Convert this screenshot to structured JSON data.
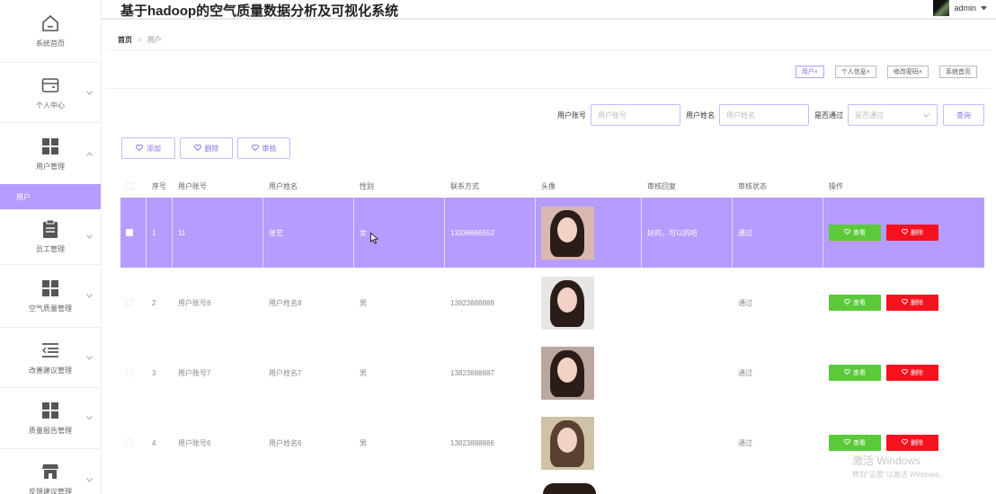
{
  "header": {
    "title": "基于hadoop的空气质量数据分析及可视化系统",
    "user": "admin"
  },
  "sidebar": {
    "home": "系统首页",
    "items": [
      {
        "label": "个人中心",
        "icon": "wallet-icon"
      },
      {
        "label": "用户管理",
        "icon": "grid-icon",
        "expanded": true,
        "sub": [
          "用户"
        ]
      },
      {
        "label": "员工管理",
        "icon": "clipboard-icon"
      },
      {
        "label": "空气质量管理",
        "icon": "grid-icon"
      },
      {
        "label": "改善建议管理",
        "icon": "list-indent-icon"
      },
      {
        "label": "质量报告管理",
        "icon": "grid-icon"
      },
      {
        "label": "反馈建议管理",
        "icon": "shop-icon"
      }
    ]
  },
  "breadcrumb": {
    "home": "首页",
    "sep": ">",
    "current": "用户"
  },
  "tags": [
    "用户×",
    "个人信息×",
    "修改密码×",
    "系统首页"
  ],
  "search": {
    "account_label": "用户账号",
    "account_placeholder": "用户账号",
    "name_label": "用户姓名",
    "name_placeholder": "用户姓名",
    "pass_label": "是否通过",
    "pass_placeholder": "是否通过",
    "query": "查询"
  },
  "actions": {
    "add": "添加",
    "delete": "删除",
    "review": "审核"
  },
  "table": {
    "columns": [
      "序号",
      "用户账号",
      "用户姓名",
      "性别",
      "联系方式",
      "头像",
      "审核回复",
      "审核状态",
      "操作"
    ],
    "rows": [
      {
        "no": "1",
        "account": "11",
        "name": "张艺",
        "gender": "女",
        "phone": "13336666552",
        "reply": "好的，可以的哈",
        "status": "通过"
      },
      {
        "no": "2",
        "account": "用户账号8",
        "name": "用户姓名8",
        "gender": "男",
        "phone": "13823888888",
        "reply": "",
        "status": "通过"
      },
      {
        "no": "3",
        "account": "用户账号7",
        "name": "用户姓名7",
        "gender": "男",
        "phone": "13823888887",
        "reply": "",
        "status": "通过"
      },
      {
        "no": "4",
        "account": "用户账号6",
        "name": "用户姓名6",
        "gender": "男",
        "phone": "13823888886",
        "reply": "",
        "status": "通过"
      }
    ],
    "view": "查看",
    "del": "删除"
  },
  "watermark": {
    "line1": "激活 Windows",
    "line2": "转到\"设置\"以激活 Windows。"
  },
  "colors": {
    "accent": "#b69cff",
    "view": "#5cc93b",
    "delete": "#f5121e"
  }
}
